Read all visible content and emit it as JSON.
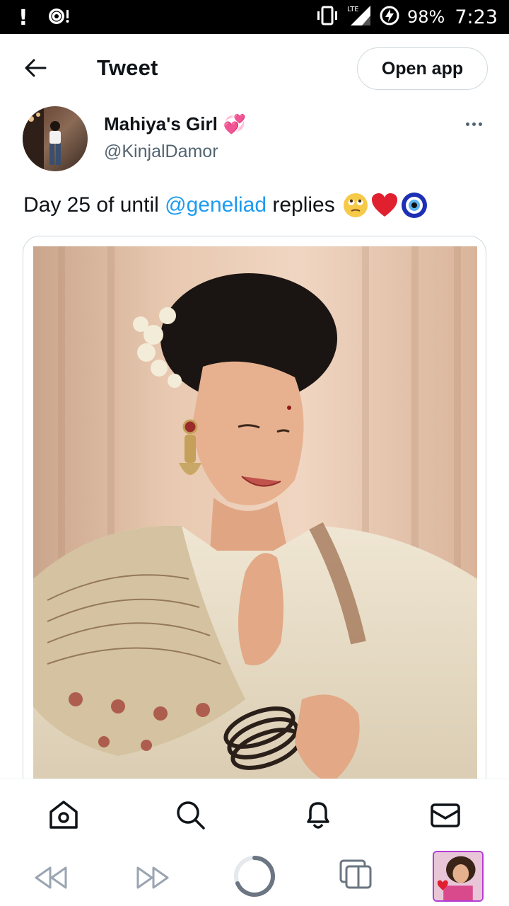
{
  "status_bar": {
    "battery": "98%",
    "time": "7:23",
    "network": "LTE",
    "icons": [
      "alert-icon",
      "disc-icon",
      "vibrate-icon",
      "signal-icon",
      "battery-charging-icon"
    ]
  },
  "header": {
    "back_icon": "back-arrow-icon",
    "title": "Tweet",
    "open_app_label": "Open app"
  },
  "tweet": {
    "author": {
      "display_name": "Mahiya's Girl",
      "name_emoji": "💞",
      "handle": "@KinjalDamor"
    },
    "text": {
      "before": "Day 25 of until ",
      "mention": "@geneliad",
      "after": " replies",
      "emojis": [
        "🙄",
        "❤️",
        "🧿"
      ]
    },
    "more_icon": "more-horizontal-icon"
  },
  "bottom_nav": {
    "items": [
      "home-icon",
      "search-icon",
      "notifications-bell-icon",
      "messages-envelope-icon"
    ]
  },
  "browser_bar": {
    "items": [
      "back-icon",
      "forward-icon",
      "reload-spinner-icon",
      "tabs-icon",
      "profile-thumbnail"
    ]
  },
  "colors": {
    "link": "#1d9bf0",
    "text": "#0f1419",
    "secondary_text": "#536471",
    "border": "#cfd9de",
    "thumbnail_border": "#b23cd6"
  }
}
